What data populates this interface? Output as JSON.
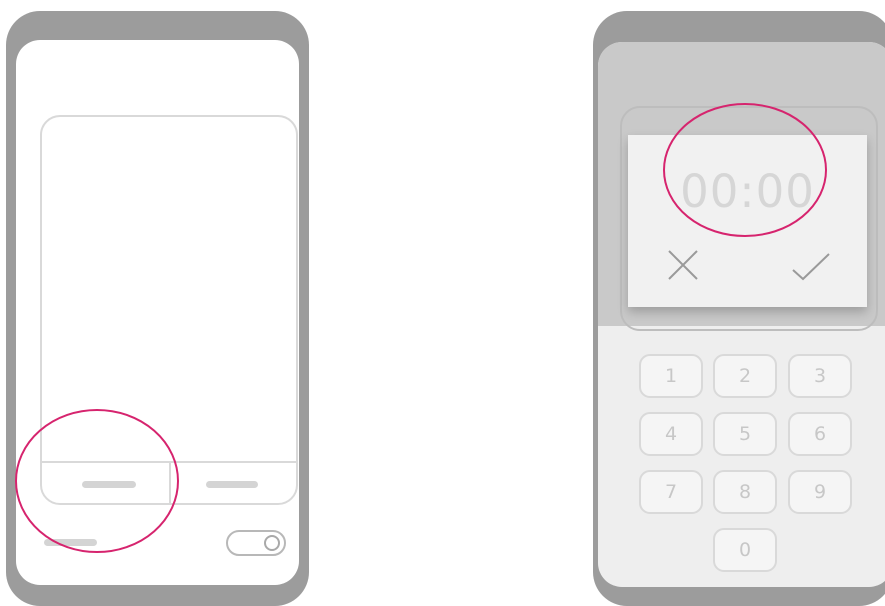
{
  "colors": {
    "phone_frame": "#9c9c9c",
    "highlight_circle": "#d6246e",
    "outline": "#d9d9d9",
    "dim_overlay": "#c9c9c9"
  },
  "timer_dialog": {
    "time_text": "00:00",
    "cancel_icon": "close-icon",
    "confirm_icon": "check-icon"
  },
  "keypad": {
    "keys": [
      "1",
      "2",
      "3",
      "4",
      "5",
      "6",
      "7",
      "8",
      "9",
      "0"
    ]
  }
}
